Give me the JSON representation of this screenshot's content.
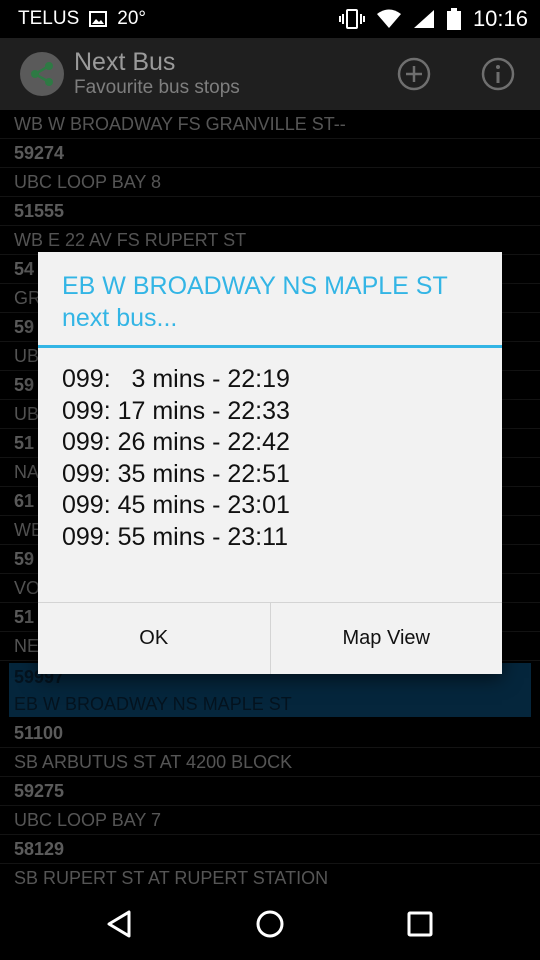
{
  "status_bar": {
    "carrier": "TELUS",
    "temperature": "20°",
    "time": "10:16"
  },
  "action_bar": {
    "title": "Next Bus",
    "subtitle": "Favourite bus stops"
  },
  "list": {
    "items": [
      {
        "text": "WB W BROADWAY FS GRANVILLE ST--",
        "kind": "name"
      },
      {
        "text": "59274",
        "kind": "code"
      },
      {
        "text": "UBC LOOP BAY 8",
        "kind": "name"
      },
      {
        "text": "51555",
        "kind": "code"
      },
      {
        "text": "WB E 22 AV FS RUPERT ST",
        "kind": "name"
      },
      {
        "text": "54",
        "kind": "code"
      },
      {
        "text": "GR",
        "kind": "name"
      },
      {
        "text": "59",
        "kind": "code"
      },
      {
        "text": "UB",
        "kind": "name"
      },
      {
        "text": "59",
        "kind": "code"
      },
      {
        "text": "UB",
        "kind": "name"
      },
      {
        "text": "51",
        "kind": "code"
      },
      {
        "text": "NA",
        "kind": "name"
      },
      {
        "text": "61",
        "kind": "code"
      },
      {
        "text": "WE",
        "kind": "name"
      },
      {
        "text": "59",
        "kind": "code"
      },
      {
        "text": "VO",
        "kind": "name"
      },
      {
        "text": "51",
        "kind": "code"
      },
      {
        "text": "NE",
        "kind": "name"
      },
      {
        "text": "59997",
        "kind": "code",
        "selected": true
      },
      {
        "text": "EB W BROADWAY NS MAPLE ST",
        "kind": "name",
        "selected": true
      },
      {
        "text": "51100",
        "kind": "code"
      },
      {
        "text": "SB ARBUTUS ST AT 4200 BLOCK",
        "kind": "name"
      },
      {
        "text": "59275",
        "kind": "code"
      },
      {
        "text": "UBC LOOP BAY 7",
        "kind": "name"
      },
      {
        "text": "58129",
        "kind": "code"
      },
      {
        "text": "SB RUPERT ST AT RUPERT STATION",
        "kind": "name"
      }
    ]
  },
  "dialog": {
    "title_line1": "EB W BROADWAY NS MAPLE ST",
    "title_line2": "next bus...",
    "arrivals": [
      "099:   3 mins - 22:19",
      "099: 17 mins - 22:33",
      "099: 26 mins - 22:42",
      "099: 35 mins - 22:51",
      "099: 45 mins - 23:01",
      "099: 55 mins - 23:11"
    ],
    "ok_label": "OK",
    "map_view_label": "Map View"
  },
  "colors": {
    "accent": "#33b5e5",
    "selected_row": "#0d5585"
  }
}
